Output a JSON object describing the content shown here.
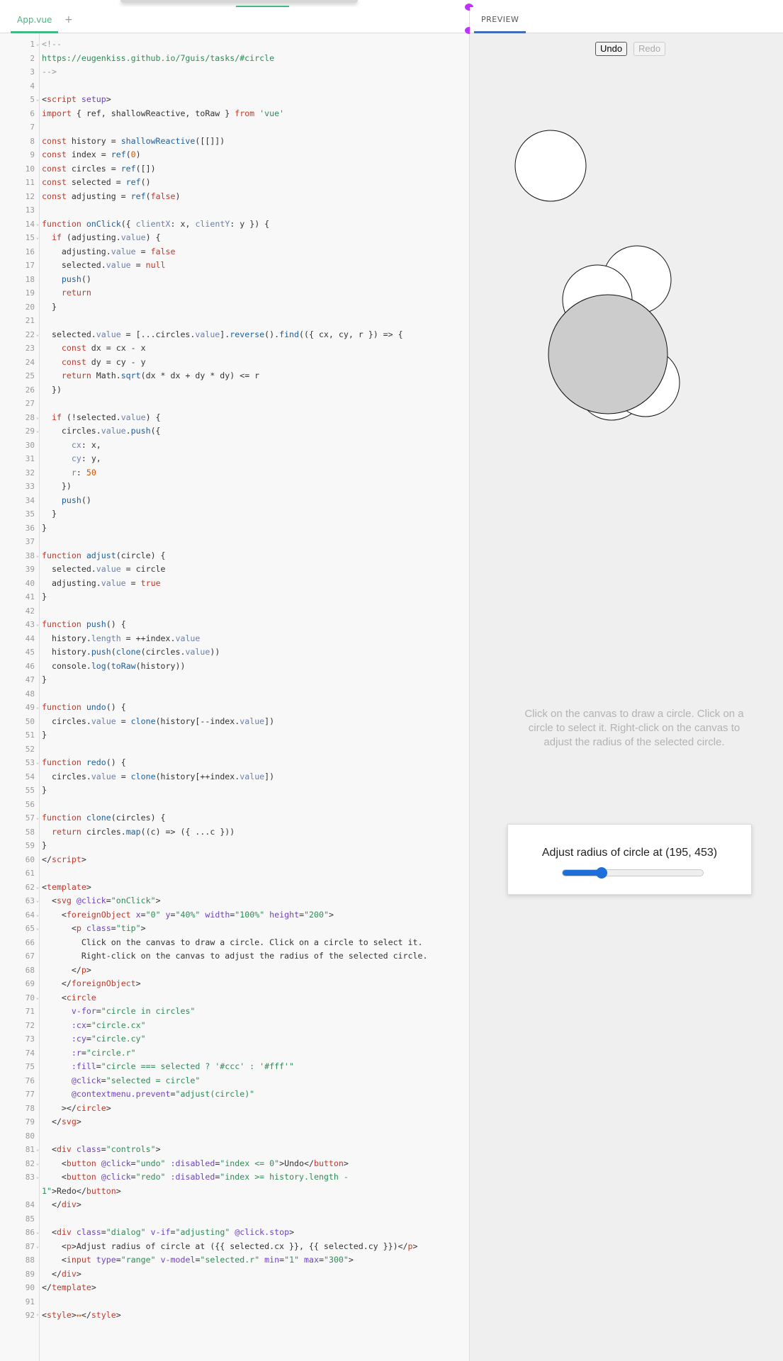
{
  "editor": {
    "tab_label": "App.vue",
    "add_tab_label": "+"
  },
  "preview": {
    "tab_label": "PREVIEW",
    "undo_label": "Undo",
    "redo_label": "Redo",
    "tip_text": "Click on the canvas to draw a circle. Click on a circle to select it. Right-click on the canvas to adjust the radius of the selected circle.",
    "dialog_title": "Adjust radius of circle at (195, 453)",
    "slider": {
      "min": 1,
      "max": 300,
      "value": 84
    }
  },
  "colors": {
    "selected_fill": "#ccc",
    "default_fill": "#fff",
    "accent": "#42b883"
  },
  "code_lines": [
    {
      "n": 1,
      "fold": true,
      "html": "<span class='c'>&lt;!--</span>"
    },
    {
      "n": 2,
      "html": "<span class='s'>https://eugenkiss.github.io/7guis/tasks/#circle</span>"
    },
    {
      "n": 3,
      "html": "<span class='c'>--&gt;</span>"
    },
    {
      "n": 4,
      "html": ""
    },
    {
      "n": 5,
      "fold": true,
      "html": "&lt;<span class='k'>script</span> <span class='a'>setup</span>&gt;"
    },
    {
      "n": 6,
      "html": "<span class='k'>import</span> { ref, shallowReactive, toRaw } <span class='k'>from</span> <span class='s'>'vue'</span>"
    },
    {
      "n": 7,
      "html": ""
    },
    {
      "n": 8,
      "html": "<span class='k'>const</span> history = <span class='f'>shallowReactive</span>([[]])"
    },
    {
      "n": 9,
      "html": "<span class='k'>const</span> index = <span class='f'>ref</span>(<span class='n'>0</span>)"
    },
    {
      "n": 10,
      "html": "<span class='k'>const</span> circles = <span class='f'>ref</span>([])"
    },
    {
      "n": 11,
      "html": "<span class='k'>const</span> selected = <span class='f'>ref</span>()"
    },
    {
      "n": 12,
      "html": "<span class='k'>const</span> adjusting = <span class='f'>ref</span>(<span class='k'>false</span>)"
    },
    {
      "n": 13,
      "html": ""
    },
    {
      "n": 14,
      "fold": true,
      "html": "<span class='k'>function</span> <span class='f'>onClick</span>({ <span class='p'>clientX</span>: x, <span class='p'>clientY</span>: y }) {"
    },
    {
      "n": 15,
      "fold": true,
      "html": "  <span class='k'>if</span> (adjusting.<span class='p'>value</span>) {"
    },
    {
      "n": 16,
      "html": "    adjusting.<span class='p'>value</span> = <span class='k'>false</span>"
    },
    {
      "n": 17,
      "html": "    selected.<span class='p'>value</span> = <span class='k'>null</span>"
    },
    {
      "n": 18,
      "html": "    <span class='f'>push</span>()"
    },
    {
      "n": 19,
      "html": "    <span class='k'>return</span>"
    },
    {
      "n": 20,
      "html": "  }"
    },
    {
      "n": 21,
      "html": ""
    },
    {
      "n": 22,
      "fold": true,
      "html": "  selected.<span class='p'>value</span> = [...circles.<span class='p'>value</span>].<span class='f'>reverse</span>().<span class='f'>find</span>(({ cx, cy, r }) =&gt; {"
    },
    {
      "n": 23,
      "html": "    <span class='k'>const</span> dx = cx - x"
    },
    {
      "n": 24,
      "html": "    <span class='k'>const</span> dy = cy - y"
    },
    {
      "n": 25,
      "html": "    <span class='k'>return</span> Math.<span class='f'>sqrt</span>(dx * dx + dy * dy) &lt;= r"
    },
    {
      "n": 26,
      "html": "  })"
    },
    {
      "n": 27,
      "html": ""
    },
    {
      "n": 28,
      "fold": true,
      "html": "  <span class='k'>if</span> (!selected.<span class='p'>value</span>) {"
    },
    {
      "n": 29,
      "fold": true,
      "html": "    circles.<span class='p'>value</span>.<span class='f'>push</span>({"
    },
    {
      "n": 30,
      "html": "      <span class='p'>cx</span>: x,"
    },
    {
      "n": 31,
      "html": "      <span class='p'>cy</span>: y,"
    },
    {
      "n": 32,
      "html": "      <span class='p'>r</span>: <span class='n'>50</span>"
    },
    {
      "n": 33,
      "html": "    })"
    },
    {
      "n": 34,
      "html": "    <span class='f'>push</span>()"
    },
    {
      "n": 35,
      "html": "  }"
    },
    {
      "n": 36,
      "html": "}"
    },
    {
      "n": 37,
      "html": ""
    },
    {
      "n": 38,
      "fold": true,
      "html": "<span class='k'>function</span> <span class='f'>adjust</span>(circle) {"
    },
    {
      "n": 39,
      "html": "  selected.<span class='p'>value</span> = circle"
    },
    {
      "n": 40,
      "html": "  adjusting.<span class='p'>value</span> = <span class='k'>true</span>"
    },
    {
      "n": 41,
      "html": "}"
    },
    {
      "n": 42,
      "html": ""
    },
    {
      "n": 43,
      "fold": true,
      "html": "<span class='k'>function</span> <span class='f'>push</span>() {"
    },
    {
      "n": 44,
      "html": "  history.<span class='p'>length</span> = ++index.<span class='p'>value</span>"
    },
    {
      "n": 45,
      "html": "  history.<span class='f'>push</span>(<span class='f'>clone</span>(circles.<span class='p'>value</span>))"
    },
    {
      "n": 46,
      "html": "  console.<span class='f'>log</span>(<span class='f'>toRaw</span>(history))"
    },
    {
      "n": 47,
      "html": "}"
    },
    {
      "n": 48,
      "html": ""
    },
    {
      "n": 49,
      "fold": true,
      "html": "<span class='k'>function</span> <span class='f'>undo</span>() {"
    },
    {
      "n": 50,
      "html": "  circles.<span class='p'>value</span> = <span class='f'>clone</span>(history[--index.<span class='p'>value</span>])"
    },
    {
      "n": 51,
      "html": "}"
    },
    {
      "n": 52,
      "html": ""
    },
    {
      "n": 53,
      "fold": true,
      "html": "<span class='k'>function</span> <span class='f'>redo</span>() {"
    },
    {
      "n": 54,
      "html": "  circles.<span class='p'>value</span> = <span class='f'>clone</span>(history[++index.<span class='p'>value</span>])"
    },
    {
      "n": 55,
      "html": "}"
    },
    {
      "n": 56,
      "html": ""
    },
    {
      "n": 57,
      "fold": true,
      "html": "<span class='k'>function</span> <span class='f'>clone</span>(circles) {"
    },
    {
      "n": 58,
      "html": "  <span class='k'>return</span> circles.<span class='f'>map</span>((c) =&gt; ({ ...c }))"
    },
    {
      "n": 59,
      "html": "}"
    },
    {
      "n": 60,
      "html": "&lt;/<span class='k'>script</span>&gt;"
    },
    {
      "n": 61,
      "html": ""
    },
    {
      "n": 62,
      "fold": true,
      "html": "&lt;<span class='k'>template</span>&gt;"
    },
    {
      "n": 63,
      "fold": true,
      "html": "  &lt;<span class='k'>svg</span> <span class='a'>@click</span>=<span class='s'>\"onClick\"</span>&gt;"
    },
    {
      "n": 64,
      "fold": true,
      "html": "    &lt;<span class='k'>foreignObject</span> <span class='a'>x</span>=<span class='s'>\"0\"</span> <span class='a'>y</span>=<span class='s'>\"40%\"</span> <span class='a'>width</span>=<span class='s'>\"100%\"</span> <span class='a'>height</span>=<span class='s'>\"200\"</span>&gt;"
    },
    {
      "n": 65,
      "fold": true,
      "html": "      &lt;<span class='k'>p</span> <span class='a'>class</span>=<span class='s'>\"tip\"</span>&gt;"
    },
    {
      "n": 66,
      "html": "        Click on the canvas to draw a circle. Click on a circle to select it."
    },
    {
      "n": 67,
      "html": "        Right-click on the canvas to adjust the radius of the selected circle."
    },
    {
      "n": 68,
      "html": "      &lt;/<span class='k'>p</span>&gt;"
    },
    {
      "n": 69,
      "html": "    &lt;/<span class='k'>foreignObject</span>&gt;"
    },
    {
      "n": 70,
      "fold": true,
      "html": "    &lt;<span class='k'>circle</span>"
    },
    {
      "n": 71,
      "html": "      <span class='a'>v-for</span>=<span class='s'>\"circle in circles\"</span>"
    },
    {
      "n": 72,
      "html": "      <span class='a'>:cx</span>=<span class='s'>\"circle.cx\"</span>"
    },
    {
      "n": 73,
      "html": "      <span class='a'>:cy</span>=<span class='s'>\"circle.cy\"</span>"
    },
    {
      "n": 74,
      "html": "      <span class='a'>:r</span>=<span class='s'>\"circle.r\"</span>"
    },
    {
      "n": 75,
      "html": "      <span class='a'>:fill</span>=<span class='s'>\"circle === selected ? '#ccc' : '#fff'\"</span>"
    },
    {
      "n": 76,
      "html": "      <span class='a'>@click</span>=<span class='s'>\"selected = circle\"</span>"
    },
    {
      "n": 77,
      "html": "      <span class='a'>@contextmenu.prevent</span>=<span class='s'>\"adjust(circle)\"</span>"
    },
    {
      "n": 78,
      "html": "    &gt;&lt;/<span class='k'>circle</span>&gt;"
    },
    {
      "n": 79,
      "html": "  &lt;/<span class='k'>svg</span>&gt;"
    },
    {
      "n": 80,
      "html": ""
    },
    {
      "n": 81,
      "fold": true,
      "html": "  &lt;<span class='k'>div</span> <span class='a'>class</span>=<span class='s'>\"controls\"</span>&gt;"
    },
    {
      "n": 82,
      "fold": true,
      "html": "    &lt;<span class='k'>button</span> <span class='a'>@click</span>=<span class='s'>\"undo\"</span> <span class='a'>:disabled</span>=<span class='s'>\"index &lt;= 0\"</span>&gt;Undo&lt;/<span class='k'>button</span>&gt;"
    },
    {
      "n": 83,
      "fold": true,
      "html": "    &lt;<span class='k'>button</span> <span class='a'>@click</span>=<span class='s'>\"redo\"</span> <span class='a'>:disabled</span>=<span class='s'>\"index &gt;= history.length -</span>"
    },
    {
      "n": "",
      "html": "<span class='s'>1\"</span>&gt;Redo&lt;/<span class='k'>button</span>&gt;"
    },
    {
      "n": 84,
      "html": "  &lt;/<span class='k'>div</span>&gt;"
    },
    {
      "n": 85,
      "html": ""
    },
    {
      "n": 86,
      "fold": true,
      "html": "  &lt;<span class='k'>div</span> <span class='a'>class</span>=<span class='s'>\"dialog\"</span> <span class='a'>v-if</span>=<span class='s'>\"adjusting\"</span> <span class='a'>@click.stop</span>&gt;"
    },
    {
      "n": 87,
      "fold": true,
      "html": "    &lt;<span class='k'>p</span>&gt;Adjust radius of circle at ({{ selected.cx }}, {{ selected.cy }})&lt;/<span class='k'>p</span>&gt;"
    },
    {
      "n": 88,
      "html": "    &lt;<span class='k'>input</span> <span class='a'>type</span>=<span class='s'>\"range\"</span> <span class='a'>v-model</span>=<span class='s'>\"selected.r\"</span> <span class='a'>min</span>=<span class='s'>\"1\"</span> <span class='a'>max</span>=<span class='s'>\"300\"</span>&gt;"
    },
    {
      "n": 89,
      "html": "  &lt;/<span class='k'>div</span>&gt;"
    },
    {
      "n": 90,
      "html": "&lt;/<span class='k'>template</span>&gt;"
    },
    {
      "n": 91,
      "html": ""
    },
    {
      "n": 92,
      "fold": "collapsed",
      "html": "&lt;<span class='k'>style</span>&gt;<span class='n'>↔</span>&lt;/<span class='k'>style</span>&gt;"
    }
  ]
}
